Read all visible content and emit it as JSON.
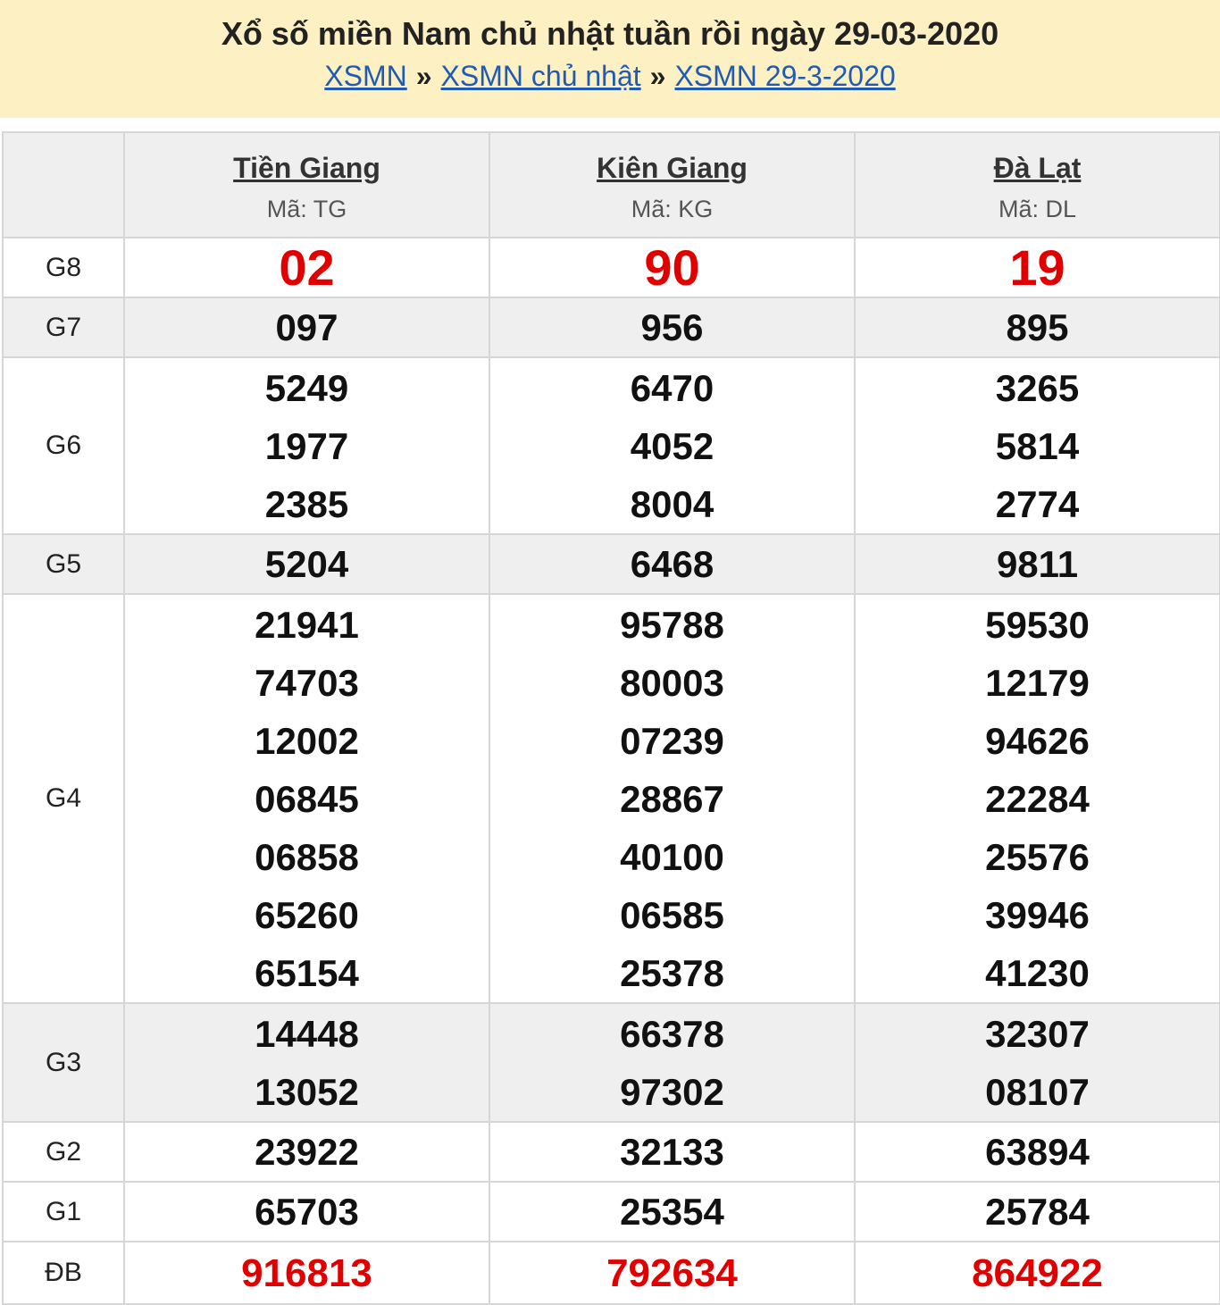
{
  "header": {
    "title": "Xổ số miền Nam chủ nhật tuần rồi ngày 29-03-2020",
    "breadcrumb": [
      {
        "label": "XSMN"
      },
      {
        "label": "XSMN chủ nhật"
      },
      {
        "label": "XSMN 29-3-2020"
      }
    ],
    "separator": "»"
  },
  "provinces": [
    {
      "name": "Tiền Giang",
      "code": "Mã: TG"
    },
    {
      "name": "Kiên Giang",
      "code": "Mã: KG"
    },
    {
      "name": "Đà Lạt",
      "code": "Mã: DL"
    }
  ],
  "prizes": {
    "g8": {
      "label": "G8",
      "values": [
        [
          "02"
        ],
        [
          "90"
        ],
        [
          "19"
        ]
      ]
    },
    "g7": {
      "label": "G7",
      "values": [
        [
          "097"
        ],
        [
          "956"
        ],
        [
          "895"
        ]
      ]
    },
    "g6": {
      "label": "G6",
      "values": [
        [
          "5249",
          "1977",
          "2385"
        ],
        [
          "6470",
          "4052",
          "8004"
        ],
        [
          "3265",
          "5814",
          "2774"
        ]
      ]
    },
    "g5": {
      "label": "G5",
      "values": [
        [
          "5204"
        ],
        [
          "6468"
        ],
        [
          "9811"
        ]
      ]
    },
    "g4": {
      "label": "G4",
      "values": [
        [
          "21941",
          "74703",
          "12002",
          "06845",
          "06858",
          "65260",
          "65154"
        ],
        [
          "95788",
          "80003",
          "07239",
          "28867",
          "40100",
          "06585",
          "25378"
        ],
        [
          "59530",
          "12179",
          "94626",
          "22284",
          "25576",
          "39946",
          "41230"
        ]
      ]
    },
    "g3": {
      "label": "G3",
      "values": [
        [
          "14448",
          "13052"
        ],
        [
          "66378",
          "97302"
        ],
        [
          "32307",
          "08107"
        ]
      ]
    },
    "g2": {
      "label": "G2",
      "values": [
        [
          "23922"
        ],
        [
          "32133"
        ],
        [
          "63894"
        ]
      ]
    },
    "g1": {
      "label": "G1",
      "values": [
        [
          "65703"
        ],
        [
          "25354"
        ],
        [
          "25784"
        ]
      ]
    },
    "db": {
      "label": "ĐB",
      "values": [
        [
          "916813"
        ],
        [
          "792634"
        ],
        [
          "864922"
        ]
      ]
    }
  },
  "colors": {
    "header_bg": "#fdf1c4",
    "link": "#1f5bb5",
    "special_number": "#e00000",
    "alt_row": "#efefef"
  }
}
